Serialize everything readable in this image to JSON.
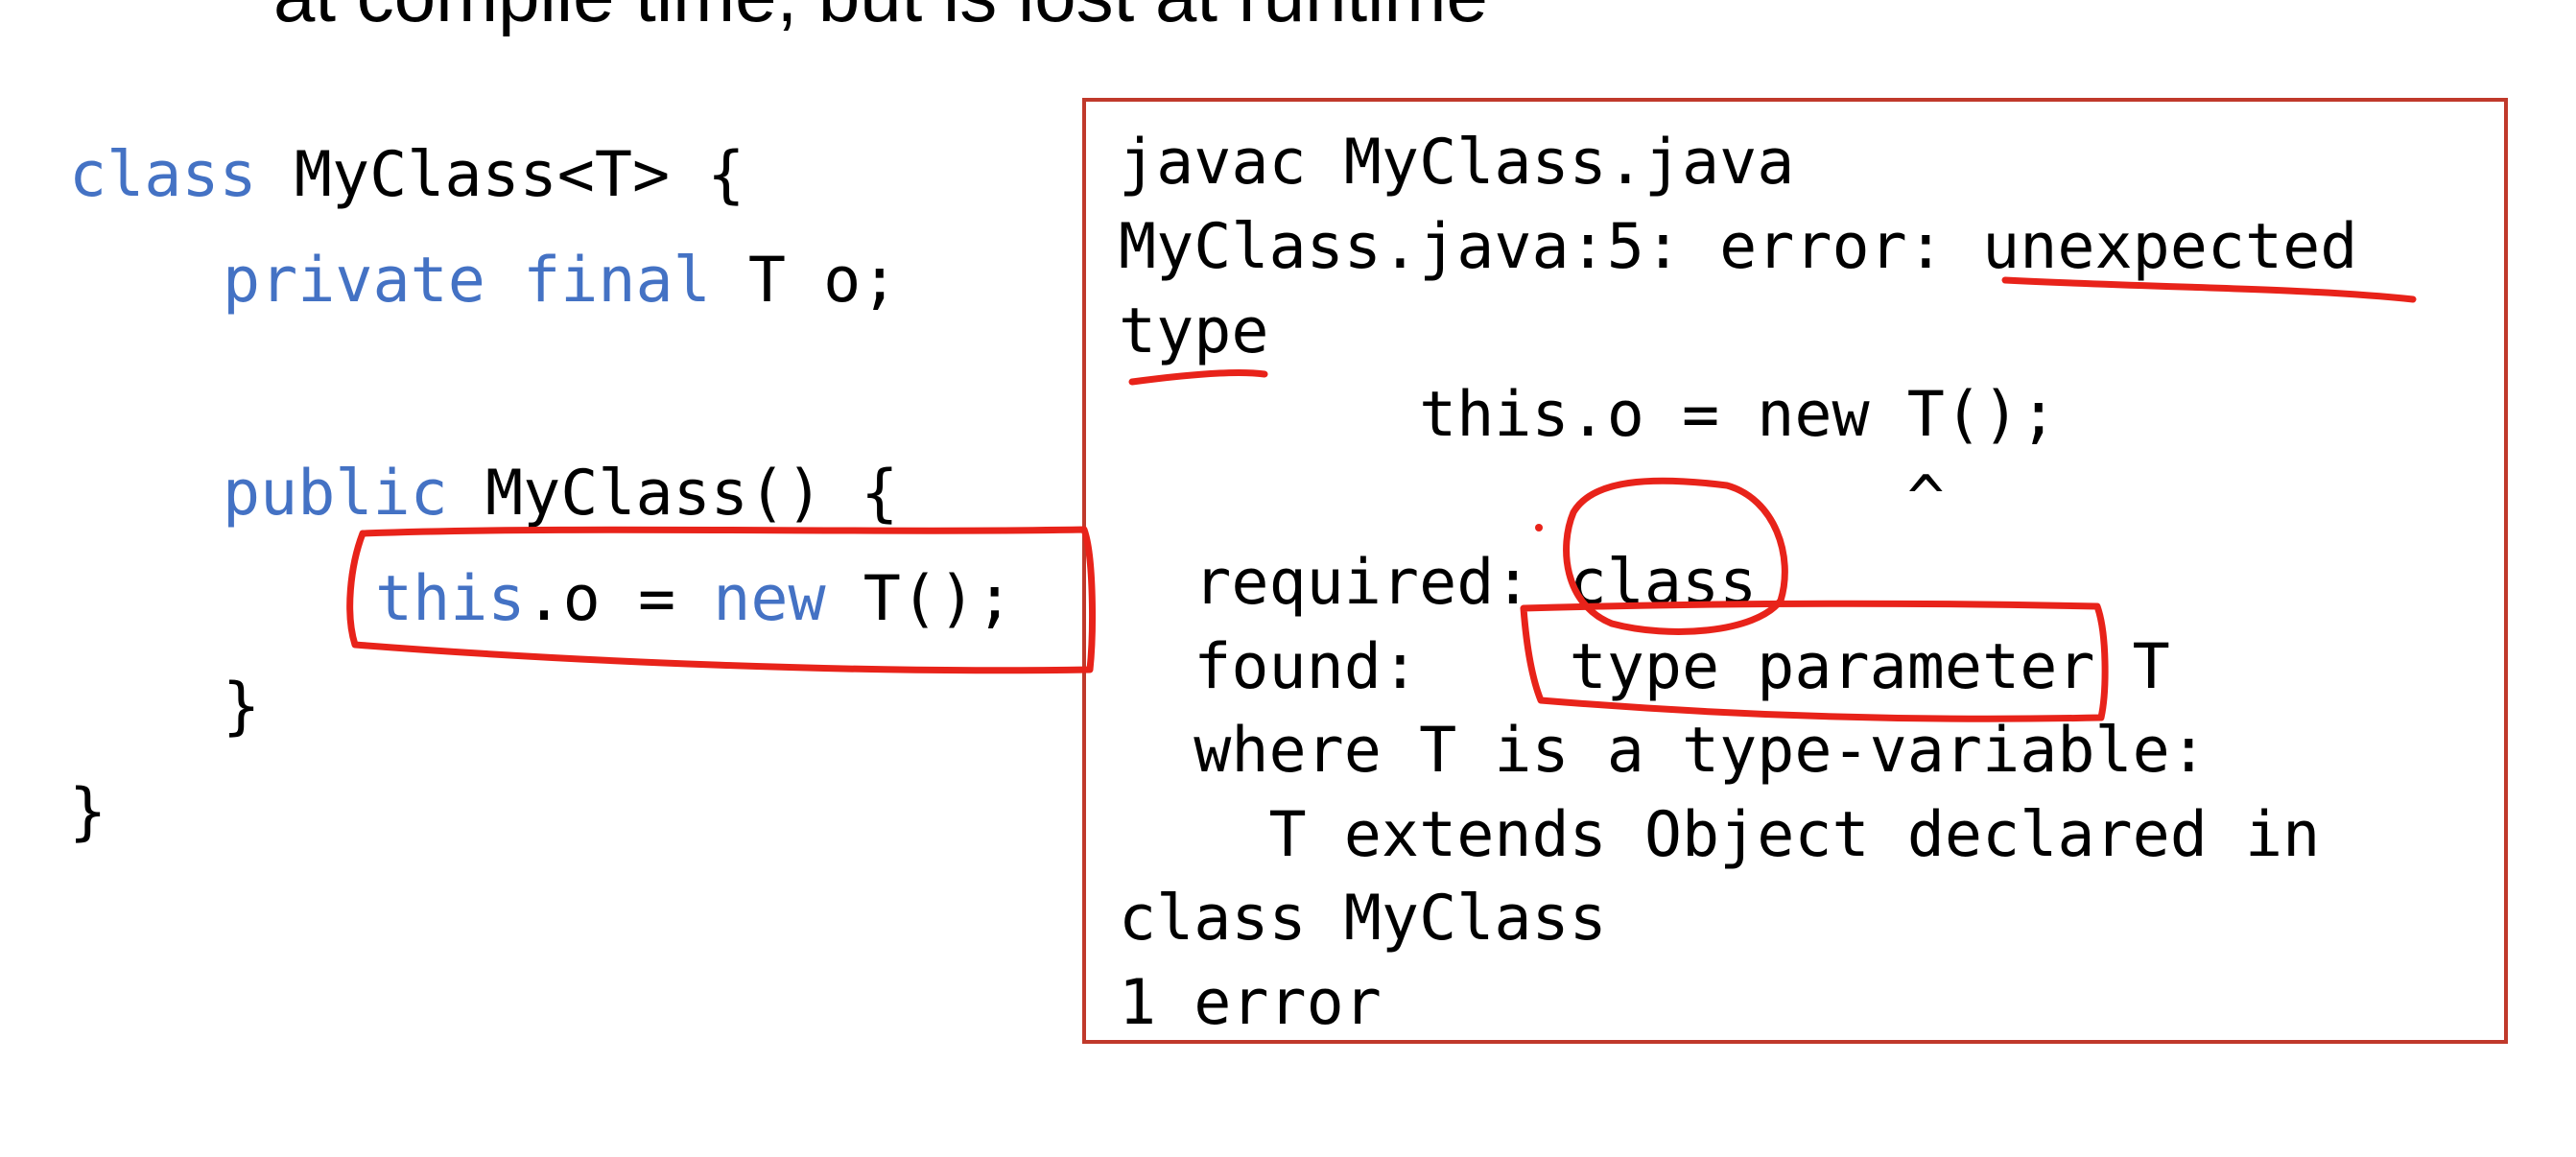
{
  "slide": {
    "top_text": "at compile time, but is lost at runtime"
  },
  "code": {
    "line1": {
      "kw": "class",
      "rest": " MyClass<T> {"
    },
    "line2": {
      "kw1": "private",
      "sp": " ",
      "kw2": "final",
      "rest": " T o;"
    },
    "line3": {
      "kw": "public",
      "rest": " MyClass() {"
    },
    "line4": {
      "kw1": "this",
      "mid": ".o = ",
      "kw2": "new",
      "rest": " T();"
    },
    "line5": "}",
    "line6": "}"
  },
  "compiler_output": {
    "lines": [
      "javac MyClass.java",
      "MyClass.java:5: error: unexpected",
      "type",
      "        this.o = new T();",
      "                     ^",
      "  required: class",
      "  found:    type parameter T",
      "  where T is a type-variable:",
      "    T extends Object declared in",
      "class MyClass",
      "1 error"
    ]
  },
  "colors": {
    "keyword": "#4472c4",
    "annotation": "#e8231a",
    "box_border": "#c0392b"
  }
}
